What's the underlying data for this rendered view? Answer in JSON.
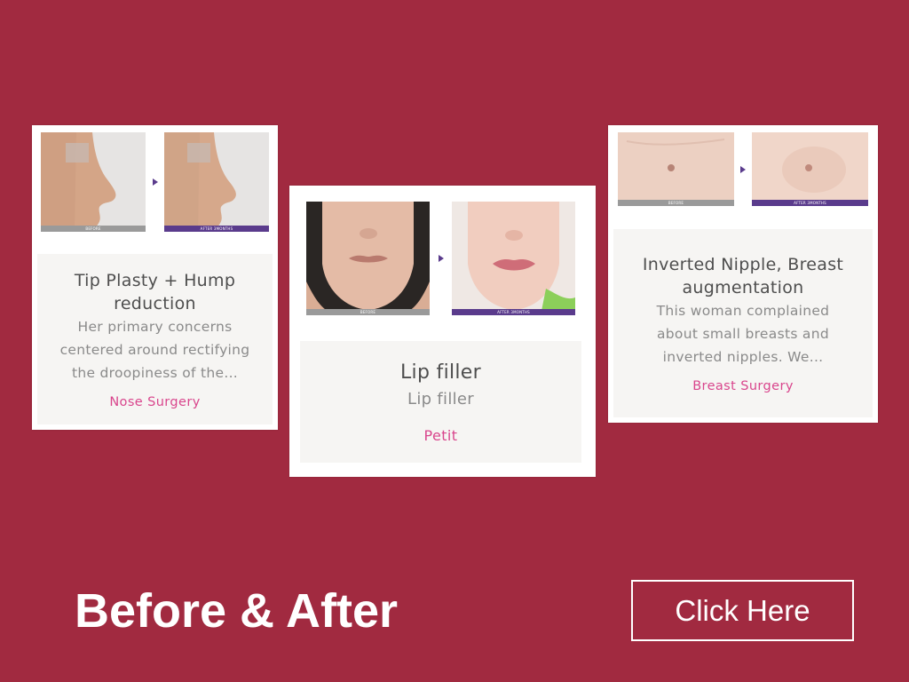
{
  "colors": {
    "background": "#a12a40",
    "card_inner": "#f6f5f3",
    "category_link": "#d9468d",
    "after_bar": "#5a3b8c",
    "before_bar": "#9a9a9a"
  },
  "cards": [
    {
      "title": "Tip Plasty + Hump reduction",
      "description": "Her primary concerns centered around rectifying the droopiness of the...",
      "category": "Nose Surgery",
      "before_label": "BEFORE",
      "after_label": "AFTER 3MONTHS"
    },
    {
      "title": "Lip filler",
      "description": "Lip filler",
      "category": "Petit",
      "before_label": "BEFORE",
      "after_label": "AFTER 3MONTHS"
    },
    {
      "title": "Inverted Nipple, Breast augmentation",
      "description": "This woman complained about small breasts and inverted nipples. We...",
      "category": "Breast Surgery",
      "before_label": "BEFORE",
      "after_label": "AFTER 3MONTHS"
    }
  ],
  "footer": {
    "headline": "Before & After",
    "cta_label": "Click Here"
  }
}
